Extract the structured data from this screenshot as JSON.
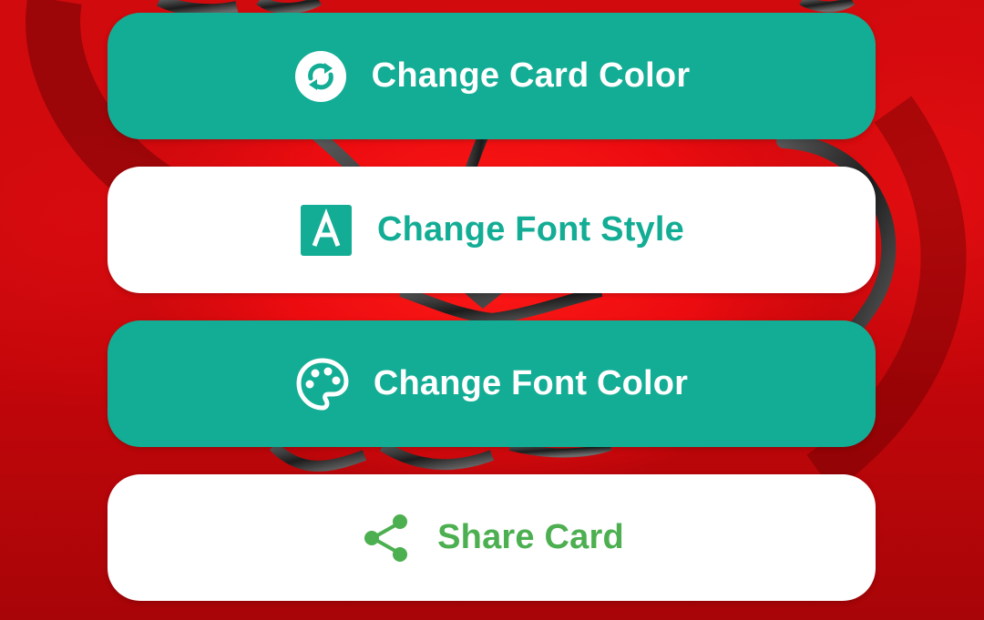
{
  "background": {
    "description_icon": "stethoscope-heart-background",
    "color": "#c9070b"
  },
  "actions": {
    "change_card_color": {
      "label": "Change Card Color",
      "icon": "sync-icon",
      "bg_color": "#13ad95",
      "text_color": "#ffffff"
    },
    "change_font_style": {
      "label": "Change Font Style",
      "icon": "font-a-icon",
      "bg_color": "#ffffff",
      "text_color": "#13ad95"
    },
    "change_font_color": {
      "label": "Change Font Color",
      "icon": "palette-icon",
      "bg_color": "#13ad95",
      "text_color": "#ffffff"
    },
    "share_card": {
      "label": "Share Card",
      "icon": "share-icon",
      "bg_color": "#ffffff",
      "text_color": "#4caf50"
    }
  }
}
